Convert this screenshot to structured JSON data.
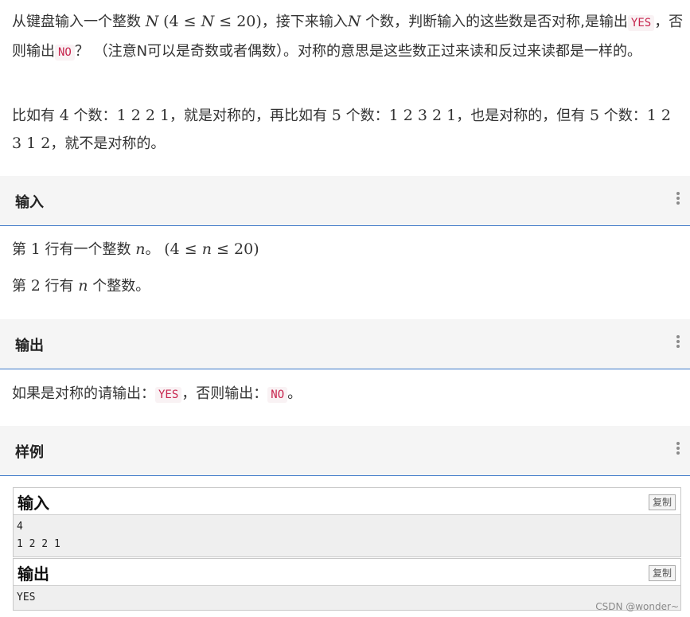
{
  "description": {
    "p1": {
      "t1": "从键盘输入一个整数 ",
      "m1": "N",
      "m2": "(4 ≤ ",
      "m3": "N",
      "m4": " ≤ 20)",
      "t2": "，接下来输入",
      "m5": "N",
      "t3": " 个数，判断输入的这些数是否对称,是输出",
      "code_yes": "YES",
      "t4": "，否则输出",
      "code_no": "NO",
      "t5": "？ （注意N可以是奇数或者偶数）。对称的意思是这些数正过来读和反过来读都是一样的。"
    },
    "p2": {
      "t1": "比如有 ",
      "n1": "4",
      "t2": " 个数：",
      "s1": "1 2 2 1",
      "t3": "，就是对称的，再比如有 ",
      "n2": "5",
      "t4": " 个数：",
      "s2": "1 2 3 2 1",
      "t5": "，也是对称的，但有 ",
      "n3": "5",
      "t6": " 个数：",
      "s3": "1 2 3 1 2",
      "t7": "，就不是对称的。"
    }
  },
  "sections": {
    "input": {
      "title": "输入",
      "line1": {
        "t1": "第 ",
        "n1": "1",
        "t2": " 行有一个整数 ",
        "m1": "n",
        "t3": "。",
        "m2": "(4 ≤ ",
        "m3": "n",
        "m4": " ≤ 20)"
      },
      "line2": {
        "t1": "第 ",
        "n1": "2",
        "t2": " 行有 ",
        "m1": "n",
        "t3": " 个整数。"
      }
    },
    "output": {
      "title": "输出",
      "line1": {
        "t1": "如果是对称的请输出：",
        "code_yes": "YES",
        "t2": "，否则输出：",
        "code_no": "NO",
        "t3": "。"
      }
    },
    "sample": {
      "title": "样例",
      "input_label": "输入",
      "input_content": "4\n1 2 2 1",
      "output_label": "输出",
      "output_content": "YES",
      "copy_label": "复制"
    }
  },
  "watermark": "CSDN @wonder~",
  "colors": {
    "accent_line": "#3c78c8",
    "code_text": "#c7254e",
    "code_bg": "#f9f2f4",
    "section_bg": "#f5f5f5"
  }
}
